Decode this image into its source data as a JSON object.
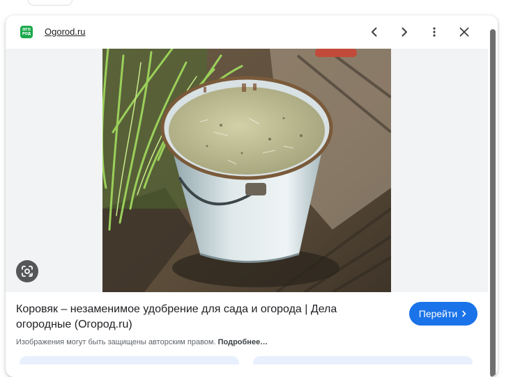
{
  "header": {
    "site_name": "Ogorod.ru",
    "logo_text": "ОГО РОД",
    "prev_icon": "chevron-left-icon",
    "next_icon": "chevron-right-icon",
    "more_icon": "more-vert-icon",
    "close_icon": "close-icon"
  },
  "image": {
    "lens_icon": "google-lens-icon"
  },
  "result": {
    "title": "Коровяк – незаменимое удобрение для сада и огорода | Дела огородные (Огород.ru)",
    "visit_label": "Перейти",
    "copyright_text": "Изображения могут быть защищены авторским правом.",
    "more_link": "Подробнее…"
  },
  "colors": {
    "accent": "#1a73e8",
    "logo": "#1ba94c",
    "image_bg": "#f1f3f4"
  }
}
